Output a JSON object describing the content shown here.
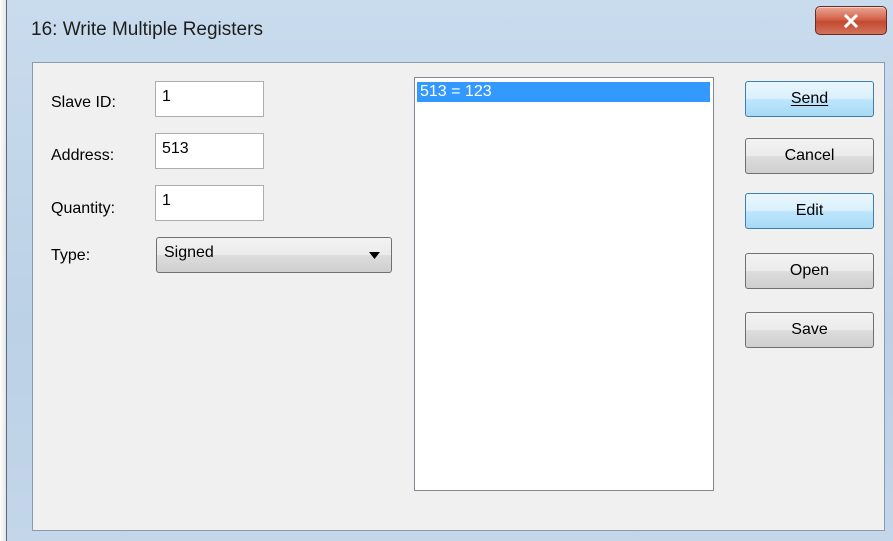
{
  "window": {
    "title": "16: Write Multiple Registers",
    "close_icon": "close-x-icon"
  },
  "form": {
    "slave_id": {
      "label": "Slave ID:",
      "value": "1"
    },
    "address": {
      "label": "Address:",
      "value": "513"
    },
    "quantity": {
      "label": "Quantity:",
      "value": "1"
    },
    "type": {
      "label": "Type:",
      "value": "Signed"
    }
  },
  "register_list": {
    "items": [
      "513 = 123"
    ],
    "selected_index": 0
  },
  "buttons": {
    "send": "Send",
    "cancel": "Cancel",
    "edit": "Edit",
    "open": "Open",
    "save": "Save"
  },
  "colors": {
    "selection": "#3399ff",
    "close_button": "#c94a30"
  }
}
